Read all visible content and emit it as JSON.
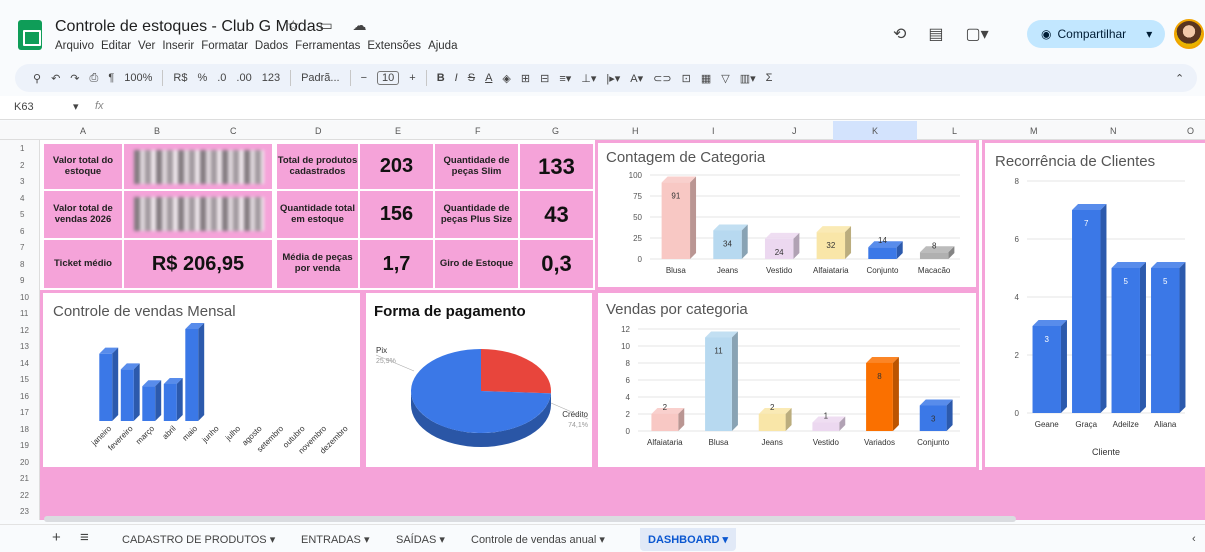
{
  "app": {
    "doc_title": "Controle de estoques - Club G Modas",
    "title_icons": "☆ ▭ ☁",
    "menu": [
      "Arquivo",
      "Editar",
      "Ver",
      "Inserir",
      "Formatar",
      "Dados",
      "Ferramentas",
      "Extensões",
      "Ajuda"
    ],
    "share_label": "Compartilhar"
  },
  "toolbar": {
    "zoom": "100%",
    "currency": "R$",
    "percent": "%",
    "dec_less": ".0",
    "dec_more": ".00",
    "format_123": "123",
    "font": "Padrã...",
    "font_size": "10",
    "bold": "B",
    "italic": "I",
    "strike": "S",
    "underline_a": "A",
    "sum": "Σ"
  },
  "formula": {
    "cell_ref": "K63",
    "fx": "fx"
  },
  "columns": [
    "A",
    "B",
    "C",
    "D",
    "E",
    "F",
    "G",
    "H",
    "I",
    "J",
    "K",
    "L",
    "M",
    "N",
    "O"
  ],
  "rows": [
    "1",
    "2",
    "3",
    "4",
    "5",
    "6",
    "7",
    "8",
    "9",
    "10",
    "11",
    "12",
    "13",
    "14",
    "15",
    "16",
    "17",
    "18",
    "19",
    "20",
    "21",
    "22",
    "23"
  ],
  "kpis": {
    "valor_total_estoque_label": "Valor total do estoque",
    "valor_total_vendas_label": "Valor total de vendas 2026",
    "ticket_label": "Ticket médio",
    "ticket_value": "R$ 206,95",
    "total_produtos_label": "Total de produtos cadastrados",
    "total_produtos_value": "203",
    "qtd_estoque_label": "Quantidade total em estoque",
    "qtd_estoque_value": "156",
    "media_pecas_label": "Média de peças por venda",
    "media_pecas_value": "1,7",
    "slim_label": "Quantidade de peças Slim",
    "slim_value": "133",
    "plus_label": "Quantidade de peças Plus Size",
    "plus_value": "43",
    "giro_label": "Giro de Estoque",
    "giro_value": "0,3"
  },
  "chart_data": [
    {
      "type": "bar",
      "title": "Contagem de Categoria",
      "categories": [
        "Blusa",
        "Jeans",
        "Vestido",
        "Alfaiataria",
        "Conjunto",
        "Macacão"
      ],
      "values": [
        91,
        34,
        24,
        32,
        14,
        8
      ],
      "ylim": [
        0,
        100
      ],
      "yticks": [
        "100",
        "75",
        "50",
        "25",
        "0"
      ],
      "colors": [
        "#f8c8c4",
        "#b7d9f0",
        "#ecd8f0",
        "#f9e6a8",
        "#3b78e7",
        "#b0b0b0"
      ]
    },
    {
      "type": "bar",
      "title": "Recorrência de Clientes",
      "categories": [
        "Geane",
        "Graça",
        "Adeilze",
        "Aliana"
      ],
      "values": [
        3,
        7,
        5,
        5
      ],
      "xlabel": "Cliente",
      "ylim": [
        0,
        8
      ],
      "yticks": [
        "8",
        "6",
        "4",
        "2",
        "0"
      ],
      "colors": [
        "#3b78e7"
      ]
    },
    {
      "type": "bar",
      "title": "Controle de vendas Mensal",
      "categories": [
        "janeiro",
        "fevereiro",
        "março",
        "abril",
        "maio",
        "junho",
        "julho",
        "agosto",
        "setembro",
        "outubro",
        "novembro",
        "dezembro"
      ],
      "values": [
        6,
        4.6,
        3.1,
        3.3,
        8.2,
        0,
        0,
        0,
        0,
        0,
        0,
        0
      ],
      "colors": [
        "#3b78e7"
      ]
    },
    {
      "type": "pie",
      "title": "Forma de pagamento",
      "labels": [
        "Pix",
        "Crédito"
      ],
      "percents": [
        "25,9%",
        "74,1%"
      ],
      "values": [
        25.9,
        74.1
      ],
      "colors": [
        "#e8453c",
        "#3b78e7"
      ]
    },
    {
      "type": "bar",
      "title": "Vendas por categoria",
      "categories": [
        "Alfaiataria",
        "Blusa",
        "Jeans",
        "Vestido",
        "Variados",
        "Conjunto"
      ],
      "values": [
        2,
        11,
        2,
        1,
        8,
        3
      ],
      "ylim": [
        0,
        12
      ],
      "yticks": [
        "12",
        "10",
        "8",
        "6",
        "4",
        "2",
        "0"
      ],
      "colors": [
        "#f8c8c4",
        "#b7d9f0",
        "#f9e6a8",
        "#ecd8f0",
        "#fa7000",
        "#3b78e7"
      ]
    }
  ],
  "tabs": {
    "add": "+",
    "list": "≡",
    "t1": "CADASTRO DE PRODUTOS ▾",
    "t2": "ENTRADAS ▾",
    "t3": "SAÍDAS ▾",
    "t4": "Controle de vendas anual ▾",
    "t5": "DASHBOARD ▾"
  }
}
